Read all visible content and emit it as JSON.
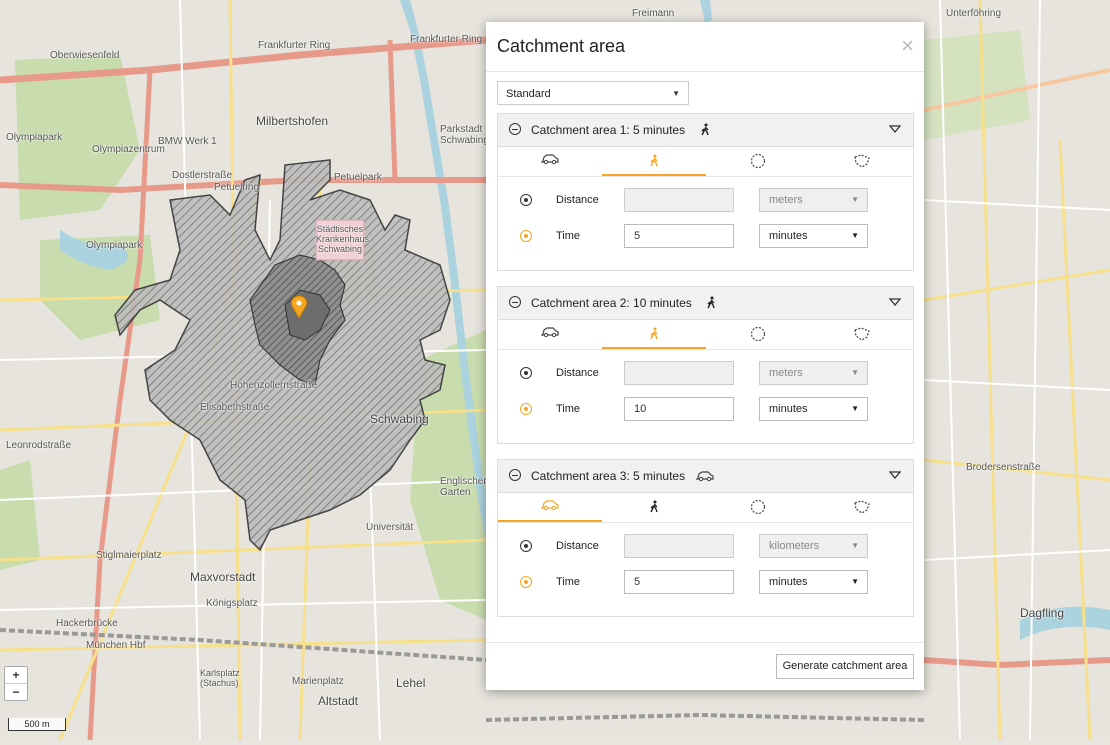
{
  "map": {
    "labels": {
      "oberwiesenfeld": "Oberwiesenfeld",
      "olympiapark": "Olympiapark",
      "olympiapark2": "Olympiapark",
      "olympiazentrum": "Olympiazentrum",
      "milbertshofen": "Milbertshofen",
      "frankfurter_ring": "Frankfurter Ring",
      "frankfurter_ring2": "Frankfurter Ring",
      "petuelring": "Petuelring",
      "petuelpark": "Petuelpark",
      "dostlerstr": "Dostlerstraße",
      "krankenhaus": "Städtisches Krankenhaus Schwabing",
      "schwabing": "Schwabing",
      "maxvorstadt": "Maxvorstadt",
      "altstadt": "Altstadt",
      "lehel": "Lehel",
      "dagfling": "Dagfling",
      "freimann": "Freimann",
      "unterfoehring": "Unterföhring",
      "elisabethstr": "Elisabethstraße",
      "hohenzollernstr": "Hohenzollernstraße",
      "leonrodstr": "Leonrodstraße",
      "universitaet": "Universität",
      "koenigsplatz": "Königsplatz",
      "stiglmaierplatz": "Stiglmaierplatz",
      "hackerbruecke": "Hackerbrücke",
      "muenchen_hbf": "München Hbf",
      "karlsplatz": "Karlsplatz (Stachus)",
      "marienplatz": "Marienplatz",
      "englischer_garten": "Englischer Garten",
      "brodersenstr": "Brodersenstraße",
      "bmw_werk": "BMW Werk 1",
      "parkstadt": "Parkstadt Schwabing"
    },
    "zoom_in": "+",
    "zoom_out": "−",
    "scale": "500 m",
    "colors": {
      "water": "#aad3df",
      "park": "#c8dcae",
      "road": "#e89a8a",
      "street": "#f7e08a",
      "polygon": "#555555",
      "marker": "#f5a623"
    }
  },
  "dialog": {
    "title": "Catchment area",
    "close_icon": "close-icon",
    "preset": "Standard",
    "generate_label": "Generate catchment area",
    "accent": "#f5a623",
    "panels": [
      {
        "title": "Catchment area  1:  5 minutes",
        "mode": "walk",
        "distance_label": "Distance",
        "time_label": "Time",
        "distance_value": "",
        "distance_unit": "meters",
        "time_value": "5",
        "time_unit": "minutes"
      },
      {
        "title": "Catchment area  2:  10 minutes",
        "mode": "walk",
        "distance_label": "Distance",
        "time_label": "Time",
        "distance_value": "",
        "distance_unit": "meters",
        "time_value": "10",
        "time_unit": "minutes"
      },
      {
        "title": "Catchment area  3:  5 minutes",
        "mode": "car",
        "distance_label": "Distance",
        "time_label": "Time",
        "distance_value": "",
        "distance_unit": "kilometers",
        "time_value": "5",
        "time_unit": "minutes"
      }
    ]
  }
}
